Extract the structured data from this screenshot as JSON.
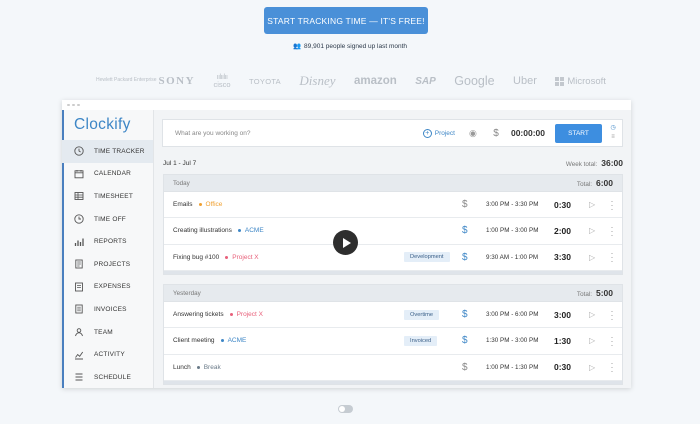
{
  "cta": {
    "label": "START TRACKING TIME — IT'S FREE!"
  },
  "signup": {
    "text": "89,901 people signed up last month"
  },
  "logos": {
    "hpe": "Hewlett Packard Enterprise",
    "sony": "SONY",
    "cisco": "cisco",
    "toyota": "TOYOTA",
    "disney": "Disney",
    "amazon": "amazon",
    "sap": "SAP",
    "google": "Google",
    "uber": "Uber",
    "microsoft": "Microsoft"
  },
  "app": {
    "brand": "Clockify",
    "nav": [
      {
        "label": "TIME TRACKER",
        "icon": "clock-icon",
        "active": true
      },
      {
        "label": "CALENDAR",
        "icon": "calendar-icon"
      },
      {
        "label": "TIMESHEET",
        "icon": "timesheet-icon"
      },
      {
        "label": "TIME OFF",
        "icon": "time-off-icon"
      },
      {
        "label": "REPORTS",
        "icon": "reports-icon"
      },
      {
        "label": "PROJECTS",
        "icon": "projects-icon"
      },
      {
        "label": "EXPENSES",
        "icon": "expenses-icon"
      },
      {
        "label": "INVOICES",
        "icon": "invoices-icon"
      },
      {
        "label": "TEAM",
        "icon": "team-icon"
      },
      {
        "label": "ACTIVITY",
        "icon": "activity-icon"
      },
      {
        "label": "SCHEDULE",
        "icon": "schedule-icon"
      }
    ],
    "timer": {
      "placeholder": "What are you working on?",
      "project_label": "Project",
      "clock": "00:00:00",
      "start_label": "START"
    },
    "week": {
      "range": "Jul 1 - Jul 7",
      "total_label": "Week total:",
      "total": "36:00"
    },
    "groups": [
      {
        "label": "Today",
        "total_label": "Total:",
        "total": "6:00",
        "entries": [
          {
            "desc": "Emails",
            "project": "Office",
            "project_color": "#f0a030",
            "tag": "",
            "billable": false,
            "range": "3:00 PM - 3:30 PM",
            "duration": "0:30"
          },
          {
            "desc": "Creating illustrations",
            "project": "ACME",
            "project_color": "#3d86c6",
            "tag": "",
            "billable": true,
            "range": "1:00 PM - 3:00 PM",
            "duration": "2:00"
          },
          {
            "desc": "Fixing bug #100",
            "project": "Project X",
            "project_color": "#e8607a",
            "tag": "Development",
            "billable": true,
            "range": "9:30 AM - 1:00 PM",
            "duration": "3:30"
          }
        ]
      },
      {
        "label": "Yesterday",
        "total_label": "Total:",
        "total": "5:00",
        "entries": [
          {
            "desc": "Answering tickets",
            "project": "Project X",
            "project_color": "#e8607a",
            "tag": "Overtime",
            "billable": true,
            "range": "3:00 PM - 6:00 PM",
            "duration": "3:00"
          },
          {
            "desc": "Client meeting",
            "project": "ACME",
            "project_color": "#3d86c6",
            "tag": "Invoiced",
            "billable": true,
            "range": "1:30 PM - 3:00 PM",
            "duration": "1:30"
          },
          {
            "desc": "Lunch",
            "project": "Break",
            "project_color": "#6a7a88",
            "tag": "",
            "billable": false,
            "range": "1:00 PM - 1:30 PM",
            "duration": "0:30"
          }
        ]
      }
    ]
  },
  "colors": {
    "accent": "#3d8ee0",
    "billable": "#3d86c6",
    "nonbillable": "#888888"
  }
}
